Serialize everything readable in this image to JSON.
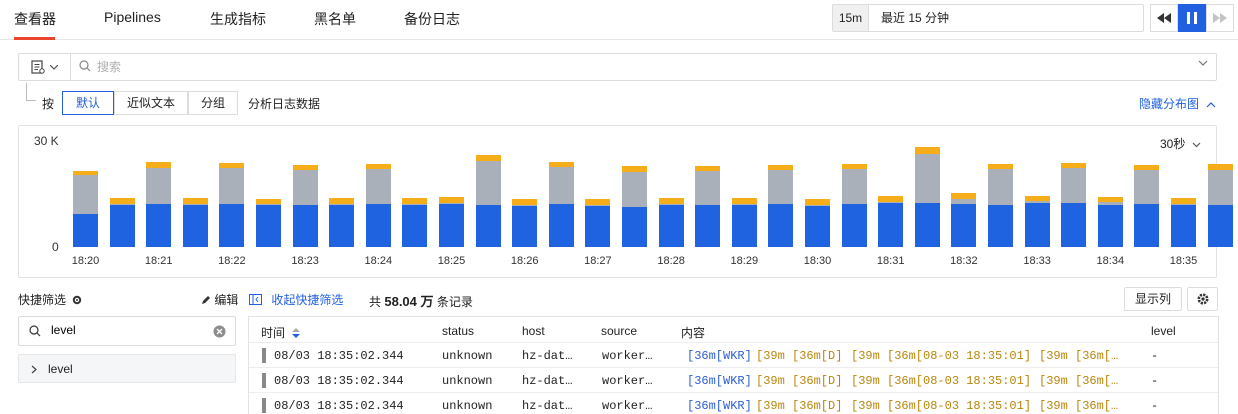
{
  "tabs": [
    {
      "label": "查看器",
      "active": true
    },
    {
      "label": "Pipelines",
      "active": false
    },
    {
      "label": "生成指标",
      "active": false
    },
    {
      "label": "黑名单",
      "active": false
    },
    {
      "label": "备份日志",
      "active": false
    }
  ],
  "time_range": {
    "short": "15m",
    "label": "最近 15 分钟"
  },
  "search": {
    "placeholder": "搜索",
    "value": ""
  },
  "group_by": {
    "prefix": "按",
    "options": [
      {
        "label": "默认",
        "active": true
      },
      {
        "label": "近似文本",
        "active": false
      },
      {
        "label": "分组",
        "active": false
      }
    ],
    "suffix": "分析日志数据"
  },
  "hide_distribution": "隐藏分布图",
  "chart_interval": "30秒",
  "chart_data": {
    "type": "bar",
    "stacked": true,
    "ylim": [
      0,
      30000
    ],
    "yticks": [
      "30 K",
      "0"
    ],
    "x_tick_labels": [
      "18:20",
      "18:21",
      "18:22",
      "18:23",
      "18:24",
      "18:25",
      "18:26",
      "18:27",
      "18:28",
      "18:29",
      "18:30",
      "18:31",
      "18:32",
      "18:33",
      "18:34",
      "18:35"
    ],
    "series": [
      {
        "color": "#2063e0",
        "values": [
          9400,
          12000,
          12300,
          12000,
          12300,
          11800,
          12000,
          11800,
          12200,
          12000,
          12300,
          11800,
          11800,
          12200,
          11600,
          11400,
          12000,
          11800,
          12000,
          12200,
          11500,
          12200,
          12400,
          12500,
          12200,
          12000,
          12500,
          12500,
          12000,
          12100,
          12000,
          12000,
          3000
        ]
      },
      {
        "color": "#aab0b9",
        "values": [
          11000,
          300,
          10000,
          300,
          10000,
          300,
          9800,
          400,
          9800,
          300,
          200,
          12500,
          200,
          10500,
          300,
          9800,
          200,
          9600,
          300,
          9500,
          400,
          9800,
          300,
          13900,
          1500,
          10000,
          400,
          9800,
          600,
          9600,
          300,
          9800,
          1000
        ]
      },
      {
        "color": "#f5ae1a",
        "values": [
          1200,
          1600,
          1700,
          1600,
          1600,
          1600,
          1500,
          1600,
          1600,
          1700,
          1600,
          1600,
          1600,
          1400,
          1600,
          1600,
          1600,
          1500,
          1600,
          1600,
          1600,
          1600,
          1600,
          1800,
          1600,
          1600,
          1600,
          1600,
          1600,
          1600,
          1600,
          1600,
          800
        ]
      }
    ]
  },
  "quick_filter": {
    "title": "快捷筛选",
    "edit": "编辑",
    "collapse": "收起快捷筛选",
    "filter_value": "level",
    "facets": [
      "level"
    ]
  },
  "total": {
    "prefix": "共",
    "count": "58.04 万",
    "suffix": "条记录"
  },
  "show_columns": "显示列",
  "table": {
    "columns": [
      "时间",
      "status",
      "host",
      "source",
      "内容",
      "level"
    ],
    "rows": [
      {
        "time": "08/03 18:35:02.344",
        "status": "unknown",
        "host": "hz-dat…",
        "source": "worker…",
        "c1": "[36m[WKR]",
        "c2": "[39m [36m[D]",
        "c3": "[39m [36m[08-03 18:35:01]",
        "c4": "[39m [36m[…",
        "level": "-"
      },
      {
        "time": "08/03 18:35:02.344",
        "status": "unknown",
        "host": "hz-dat…",
        "source": "worker…",
        "c1": "[36m[WKR]",
        "c2": "[39m [36m[D]",
        "c3": "[39m [36m[08-03 18:35:01]",
        "c4": "[39m [36m[…",
        "level": "-"
      },
      {
        "time": "08/03 18:35:02.344",
        "status": "unknown",
        "host": "hz-dat…",
        "source": "worker…",
        "c1": "[36m[WKR]",
        "c2": "[39m [36m[D]",
        "c3": "[39m [36m[08-03 18:35:01]",
        "c4": "[39m [36m[…",
        "level": "-"
      }
    ]
  }
}
